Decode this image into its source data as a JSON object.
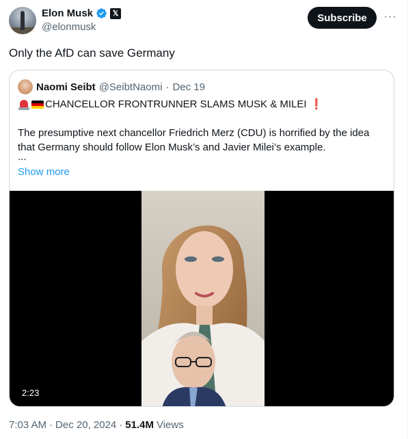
{
  "author": {
    "name": "Elon Musk",
    "handle": "@elonmusk",
    "verified_icon": "verified-badge-icon",
    "affiliate_icon": "x-logo-icon",
    "affiliate_glyph": "𝕏"
  },
  "actions": {
    "subscribe_label": "Subscribe",
    "more_glyph": "···"
  },
  "tweet": {
    "text": "Only the AfD can save Germany"
  },
  "quoted": {
    "name": "Naomi Seibt",
    "handle": "@SeibtNaomi",
    "separator": "·",
    "date": "Dec 19",
    "headline": "CHANCELLOR FRONTRUNNER SLAMS MUSK & MILEI",
    "headline_suffix": "❗",
    "body": "The presumptive next chancellor Friedrich Merz (CDU) is horrified by the idea that Germany should follow Elon Musk’s and Javier Milei’s example.",
    "ellipsis": "...",
    "show_more_label": "Show more",
    "video_duration": "2:23"
  },
  "meta": {
    "time": "7:03 AM",
    "sep1": "·",
    "date": "Dec 20, 2024",
    "sep2": "·",
    "views_count": "51.4M",
    "views_label": "Views"
  },
  "colors": {
    "link": "#1d9bf0",
    "verified": "#1d9bf0",
    "muted": "#536471",
    "border": "#cfd9de"
  }
}
